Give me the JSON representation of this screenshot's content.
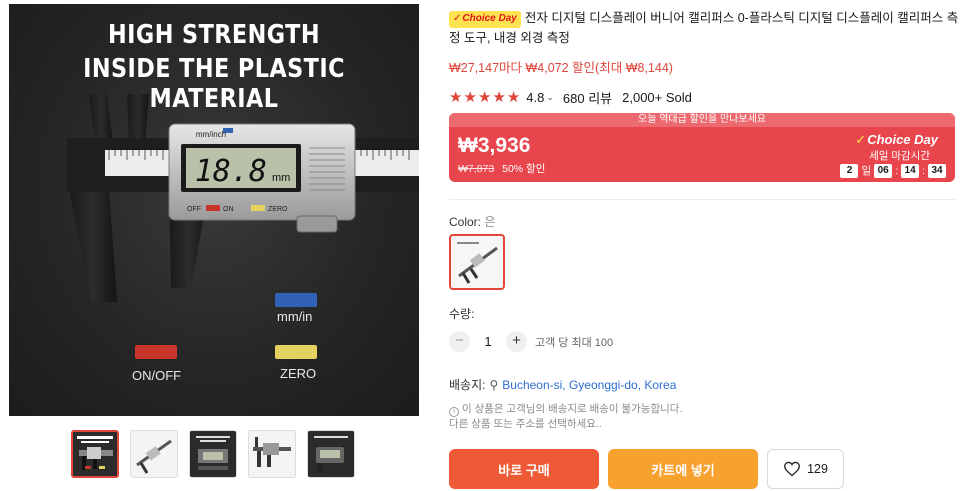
{
  "gallery": {
    "headline_line1": "HIGH STRENGTH",
    "headline_line2": "INSIDE THE PLASTIC MATERIAL",
    "display_reading": "18.8",
    "display_unit": "mm",
    "unit_tag": "mm/inch",
    "panel_off": "OFF",
    "panel_on": "ON",
    "panel_zero": "ZERO",
    "label_mm_inch": "mm/in",
    "label_on_off": "ON/OFF",
    "label_zero": "ZERO",
    "thumbnail_count": 5,
    "active_thumbnail": 1
  },
  "product": {
    "choice_badge": "Choice Day",
    "title": "전자 디지털 디스플레이 버니어 캘리퍼스 0-플라스틱 디지털 디스플레이 캘리퍼스 측정 도구, 내경 외경 측정",
    "promo_text": "₩27,147마다 ₩4,072 할인(최대 ₩8,144)",
    "rating": "4.8",
    "review_count": "680 리뷰",
    "sold": "2,000+ Sold"
  },
  "deal": {
    "banner": "오늘 역대급 할인을 만나보세요",
    "price": "₩3,936",
    "original_price": "₩7,873",
    "discount": "50% 할인",
    "brand": "Choice Day",
    "deadline_label": "세일 마감시간",
    "countdown": {
      "days": "2",
      "day_unit": "일",
      "hours": "06",
      "minutes": "14",
      "seconds": "34"
    }
  },
  "options": {
    "color_label": "Color:",
    "color_value": "은",
    "quantity_label": "수량:",
    "quantity": "1",
    "quantity_limit": "고객 당 최대 100"
  },
  "shipping": {
    "label": "배송지:",
    "location": "Bucheon-si, Gyeonggi-do, Korea",
    "warning_line1": "이 상품은 고객님의 배송지로 배송이 불가능합니다.",
    "warning_line2": "다른 상품 또는 주소를 선택하세요.."
  },
  "actions": {
    "buy_now": "바로 구매",
    "add_to_cart": "카트에 넣기",
    "wishlist_count": "129"
  },
  "colors": {
    "accent": "#e0453a",
    "deal_bg": "#e8454d",
    "buy_button": "#ee5a35",
    "cart_button": "#f7a12f",
    "link": "#2d6dd1"
  }
}
